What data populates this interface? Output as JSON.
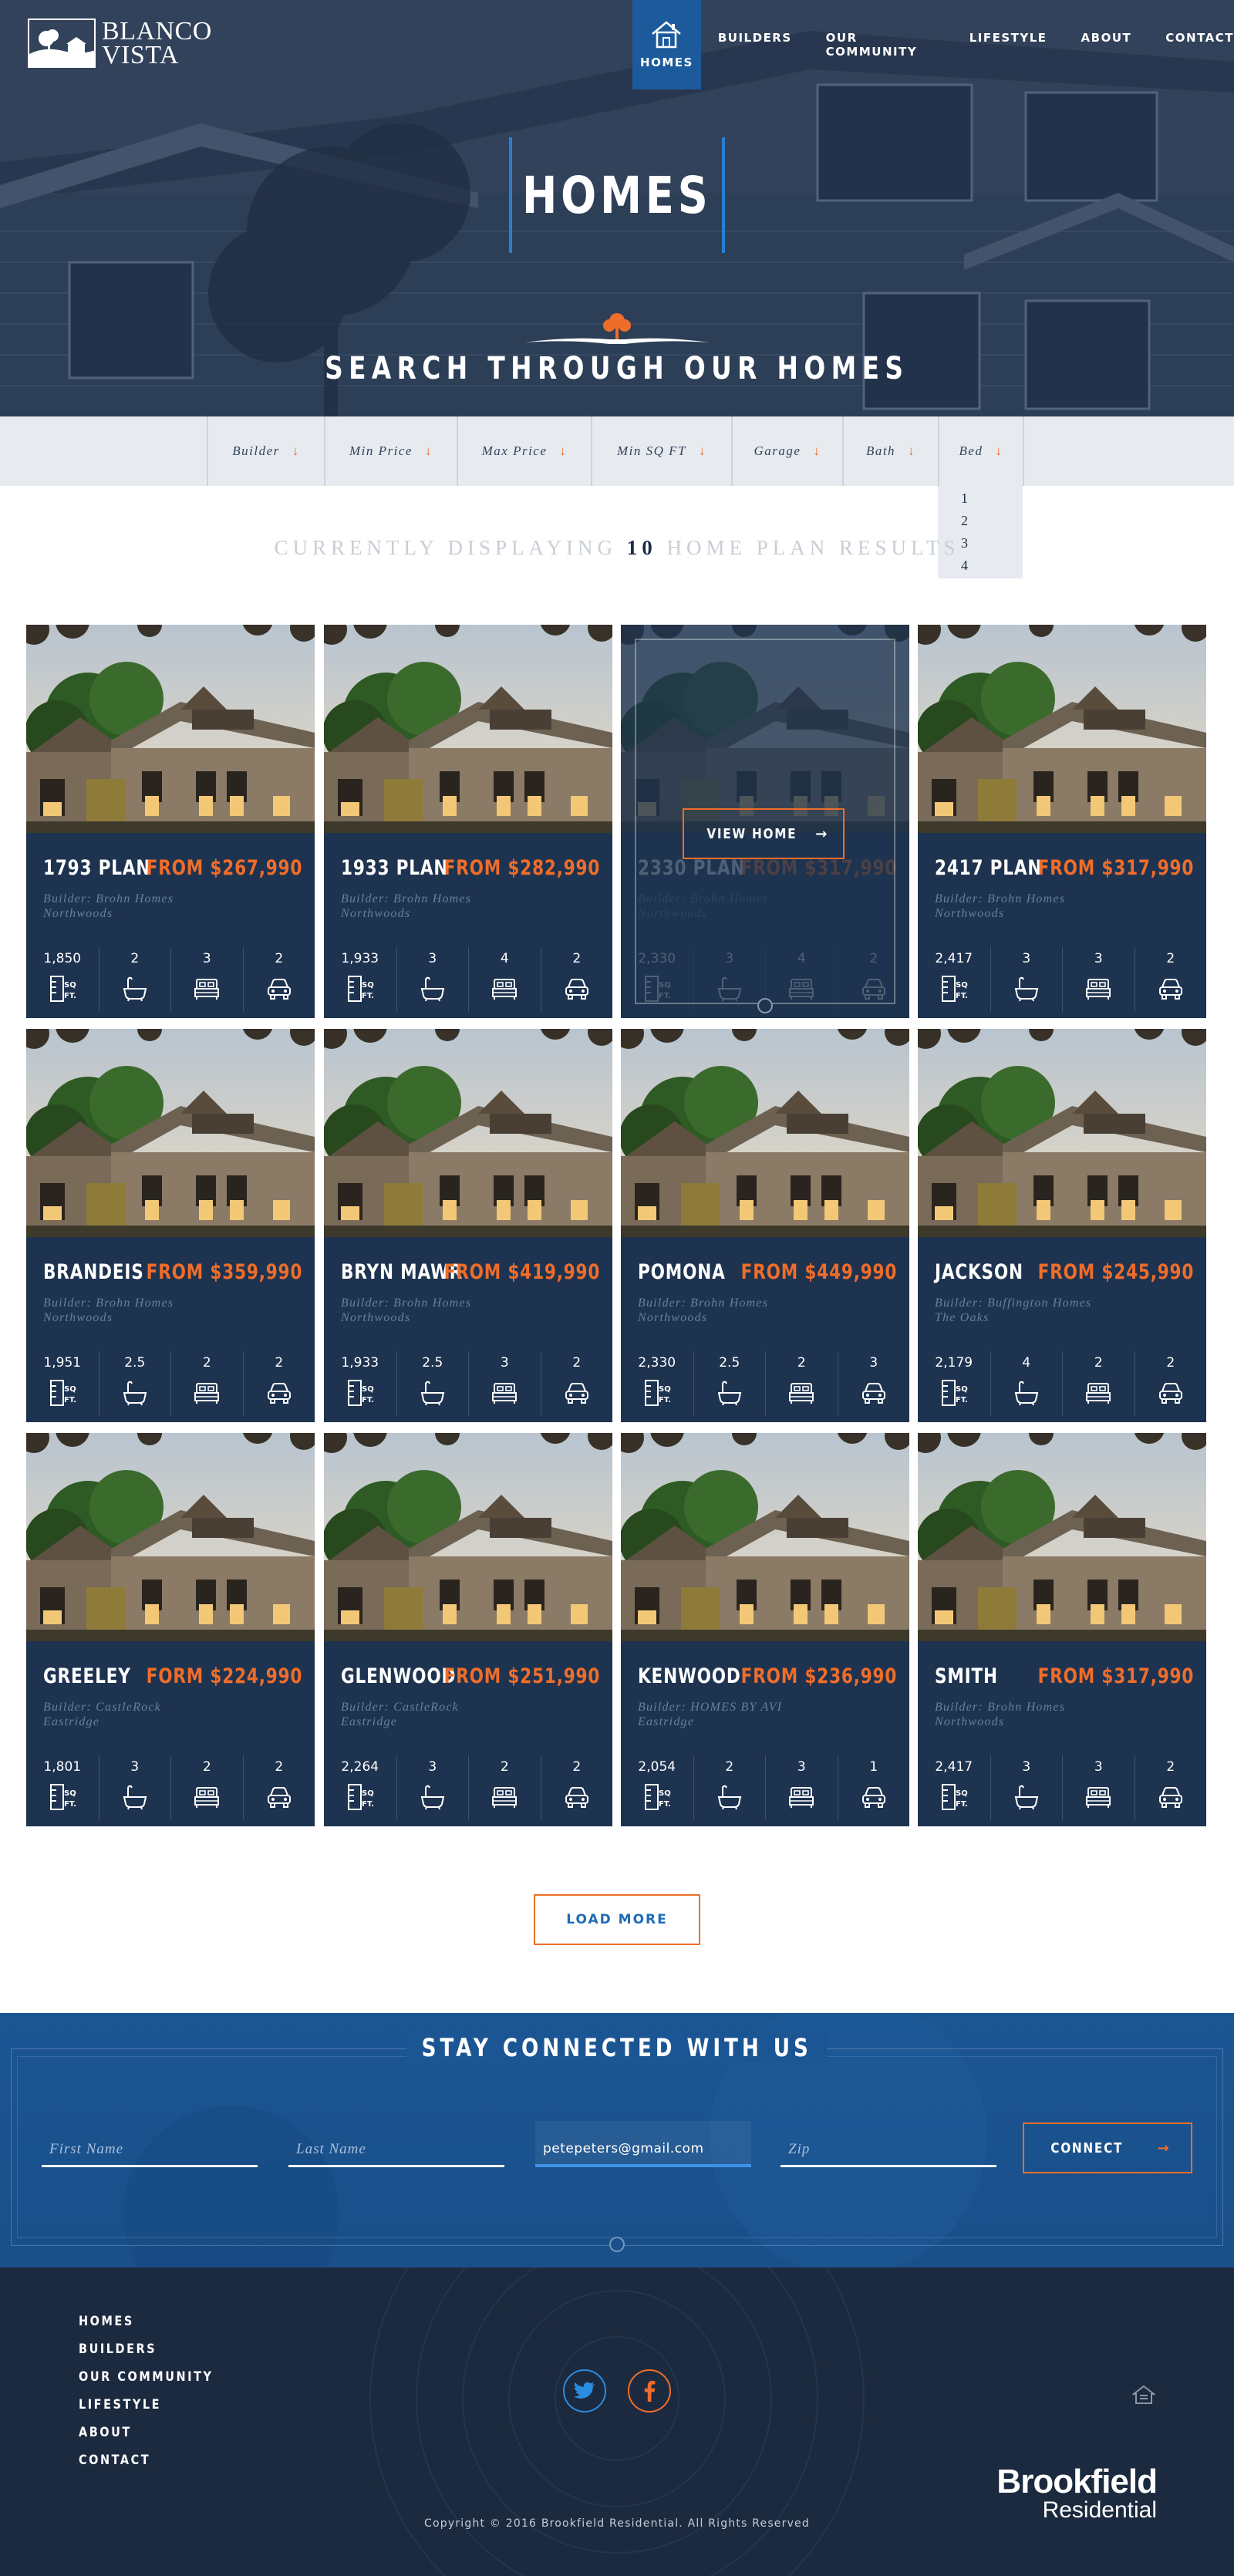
{
  "site": {
    "logo_line1": "BLANCO",
    "logo_line2": "VISTA"
  },
  "nav": {
    "active": "HOMES",
    "items": [
      "BUILDERS",
      "OUR COMMUNITY",
      "LIFESTYLE",
      "ABOUT",
      "CONTACT"
    ]
  },
  "hero": {
    "title": "HOMES",
    "subtitle": "SEARCH THROUGH OUR HOMES"
  },
  "filters": [
    "Builder",
    "Min Price",
    "Max Price",
    "Min SQ FT",
    "Garage",
    "Bath",
    "Bed"
  ],
  "bed_options": [
    "1",
    "2",
    "3",
    "4"
  ],
  "results": {
    "prefix": "CURRENTLY DISPLAYING",
    "count": "10",
    "suffix": "HOME PLAN RESULTS"
  },
  "view_home_label": "VIEW HOME",
  "sqft_label": "SQ. FT.",
  "homes": [
    {
      "name": "1793 PLAN",
      "price": "FROM $267,990",
      "builder": "Builder: Brohn Homes",
      "community": "Northwoods",
      "sqft": "1,850",
      "bath": "2",
      "bed": "3",
      "garage": "2"
    },
    {
      "name": "1933 PLAN",
      "price": "FROM $282,990",
      "builder": "Builder: Brohn Homes",
      "community": "Northwoods",
      "sqft": "1,933",
      "bath": "3",
      "bed": "4",
      "garage": "2"
    },
    {
      "name": "2330 PLAN",
      "price": "FROM $317,990",
      "builder": "Builder: Brohn Homes",
      "community": "Northwoods",
      "sqft": "2,330",
      "bath": "3",
      "bed": "4",
      "garage": "2"
    },
    {
      "name": "2417 PLAN",
      "price": "FROM $317,990",
      "builder": "Builder: Brohn Homes",
      "community": "Northwoods",
      "sqft": "2,417",
      "bath": "3",
      "bed": "3",
      "garage": "2"
    },
    {
      "name": "BRANDEIS",
      "price": "FROM $359,990",
      "builder": "Builder: Brohn Homes",
      "community": "Northwoods",
      "sqft": "1,951",
      "bath": "2.5",
      "bed": "2",
      "garage": "2"
    },
    {
      "name": "BRYN MAWR",
      "price": "FROM $419,990",
      "builder": "Builder: Brohn Homes",
      "community": "Northwoods",
      "sqft": "1,933",
      "bath": "2.5",
      "bed": "3",
      "garage": "2"
    },
    {
      "name": "POMONA",
      "price": "FROM $449,990",
      "builder": "Builder: Brohn Homes",
      "community": "Northwoods",
      "sqft": "2,330",
      "bath": "2.5",
      "bed": "2",
      "garage": "3"
    },
    {
      "name": "JACKSON",
      "price": "FROM $245,990",
      "builder": "Builder: Buffington Homes",
      "community": "The Oaks",
      "sqft": "2,179",
      "bath": "4",
      "bed": "2",
      "garage": "2"
    },
    {
      "name": "GREELEY",
      "price": "FORM $224,990",
      "builder": "Builder: CastleRock",
      "community": "Eastridge",
      "sqft": "1,801",
      "bath": "3",
      "bed": "2",
      "garage": "2"
    },
    {
      "name": "GLENWOOD",
      "price": "FROM $251,990",
      "builder": "Builder: CastleRock",
      "community": "Eastridge",
      "sqft": "2,264",
      "bath": "3",
      "bed": "2",
      "garage": "2"
    },
    {
      "name": "KENWOOD",
      "price": "FROM $236,990",
      "builder": "Builder: HOMES BY AVI",
      "community": "Eastridge",
      "sqft": "2,054",
      "bath": "2",
      "bed": "3",
      "garage": "1"
    },
    {
      "name": "SMITH",
      "price": "FROM $317,990",
      "builder": "Builder: Brohn Homes",
      "community": "Northwoods",
      "sqft": "2,417",
      "bath": "3",
      "bed": "3",
      "garage": "2"
    }
  ],
  "load_more": "LOAD MORE",
  "connect": {
    "title": "STAY CONNECTED WITH US",
    "first_name_placeholder": "First Name",
    "last_name_placeholder": "Last Name",
    "email_value": "petepeters@gmail.com",
    "zip_placeholder": "Zip",
    "button": "CONNECT"
  },
  "footer": {
    "links": [
      "HOMES",
      "BUILDERS",
      "OUR COMMUNITY",
      "LIFESTYLE",
      "ABOUT",
      "CONTACT"
    ],
    "brand_line1": "Brookfield",
    "brand_line2": "Residential",
    "copyright": "Copyright © 2016 Brookfield Residential. All Rights Reserved"
  },
  "colors": {
    "navy": "#1e3350",
    "accent_orange": "#ef6d2a",
    "accent_blue": "#1d5a9c",
    "filter_bg": "#e7ebf0"
  },
  "icons": [
    "home-icon",
    "tree-emblem-icon",
    "chevron-down-icon",
    "sqft-icon",
    "bath-icon",
    "bed-icon",
    "car-icon",
    "arrow-right-icon",
    "twitter-icon",
    "facebook-icon",
    "equal-housing-icon"
  ]
}
